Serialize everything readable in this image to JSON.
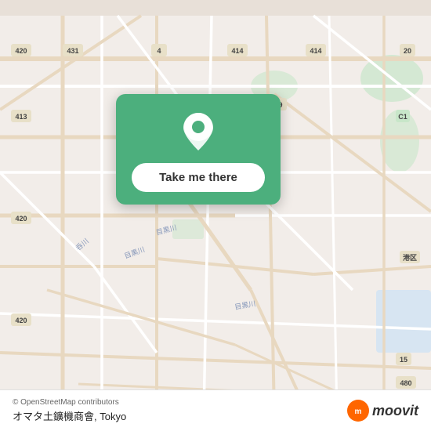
{
  "map": {
    "attribution": "© OpenStreetMap contributors",
    "location": "Tokyo",
    "background_color": "#f2ede9"
  },
  "card": {
    "button_label": "Take me there",
    "background_color": "#4caf7d"
  },
  "bottom_bar": {
    "osm_credit": "© OpenStreetMap contributors",
    "place_name": "オマタ土鑛機商會, Tokyo",
    "brand": "moovit"
  },
  "roads": {
    "accent": "#ffffff",
    "secondary": "#ddd0c0",
    "primary": "#f5f0e8"
  }
}
